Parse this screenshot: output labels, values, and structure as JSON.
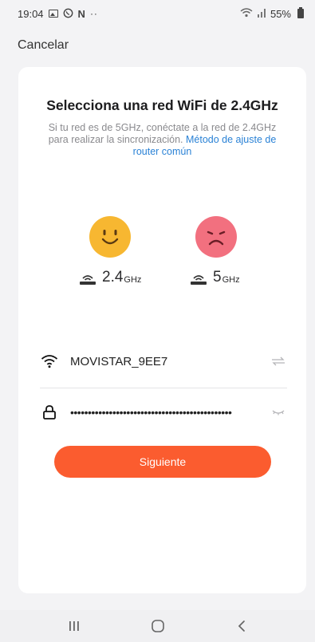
{
  "status_bar": {
    "time": "19:04",
    "left_letter": "N",
    "dots": "··",
    "battery": "55%"
  },
  "header": {
    "cancel_label": "Cancelar"
  },
  "card": {
    "title": "Selecciona una red WiFi de 2.4GHz",
    "subtitle_text": "Si tu red es de 5GHz, conéctate a la red de 2.4GHz para realizar la sincronización. ",
    "subtitle_link": "Método de ajuste de router común",
    "bands": [
      {
        "value": "2.4",
        "unit": "GHz",
        "face": "happy",
        "color": "#f7b731"
      },
      {
        "value": "5",
        "unit": "GHz",
        "face": "sad",
        "color": "#f2707f"
      }
    ]
  },
  "form": {
    "ssid_value": "MOVISTAR_9EE7",
    "password_value": "••••••••••••••••••••••••••••••••••••••••••••••",
    "next_label": "Siguiente"
  },
  "colors": {
    "accent": "#fb5c2f",
    "link": "#2a82d6",
    "happy": "#f7b731",
    "sad": "#f2707f"
  },
  "icons": {
    "ssid": "wifi-icon",
    "ssid_action": "switch-network-icon",
    "password": "lock-icon",
    "password_action": "hide-password-icon"
  }
}
